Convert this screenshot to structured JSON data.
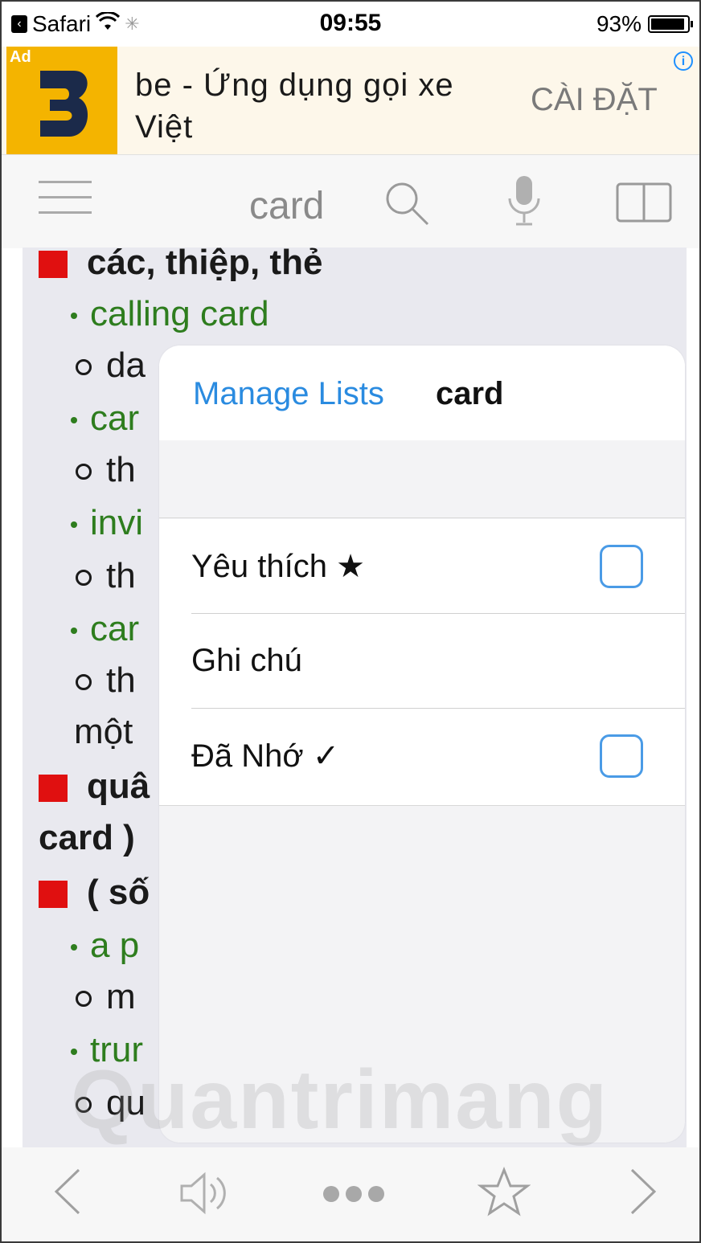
{
  "status_bar": {
    "back_app": "Safari",
    "time": "09:55",
    "battery_percent": "93%",
    "battery_level": 0.93
  },
  "ad": {
    "badge": "Ad",
    "text": "be - Ứng dụng gọi xe Việt",
    "cta": "CÀI ĐẶT",
    "brand_color": "#f4b400"
  },
  "toolbar": {
    "search_word": "card",
    "icons": [
      "menu-icon",
      "search-icon",
      "microphone-icon",
      "book-icon"
    ]
  },
  "entry": {
    "lines": [
      {
        "kind": "heading",
        "text": "các, thiệp, thẻ"
      },
      {
        "kind": "example",
        "text": "calling card"
      },
      {
        "kind": "translation",
        "text": "da"
      },
      {
        "kind": "example",
        "text": "car"
      },
      {
        "kind": "translation",
        "text": "th"
      },
      {
        "kind": "example",
        "text": "invi"
      },
      {
        "kind": "translation",
        "text": "th"
      },
      {
        "kind": "example",
        "text": "car"
      },
      {
        "kind": "translation",
        "text": "th"
      },
      {
        "kind": "plain",
        "text": "một"
      },
      {
        "kind": "heading",
        "text": "quâ"
      },
      {
        "kind": "plain-bold",
        "text": "card )"
      },
      {
        "kind": "heading",
        "text": "( số"
      },
      {
        "kind": "example",
        "text": "a p"
      },
      {
        "kind": "translation",
        "text": "m"
      },
      {
        "kind": "example",
        "text": "trur"
      },
      {
        "kind": "translation",
        "text": "qu"
      }
    ]
  },
  "popup": {
    "manage_label": "Manage Lists",
    "word": "card",
    "rows": [
      {
        "label": "Yêu thích ★",
        "has_checkbox": true,
        "checked": false
      },
      {
        "label": "Ghi chú",
        "has_checkbox": false
      },
      {
        "label": "Đã Nhớ ✓",
        "has_checkbox": true,
        "checked": false
      }
    ],
    "accent_color": "#2a8be0"
  },
  "watermark": "Quantrimang",
  "bottom_bar": {
    "icons": [
      "back-arrow-icon",
      "speaker-icon",
      "more-icon",
      "star-icon",
      "forward-arrow-icon"
    ]
  },
  "colors": {
    "heading_square": "#e01010",
    "example_green": "#2e7d1e",
    "content_bg": "#e9e9ef"
  }
}
